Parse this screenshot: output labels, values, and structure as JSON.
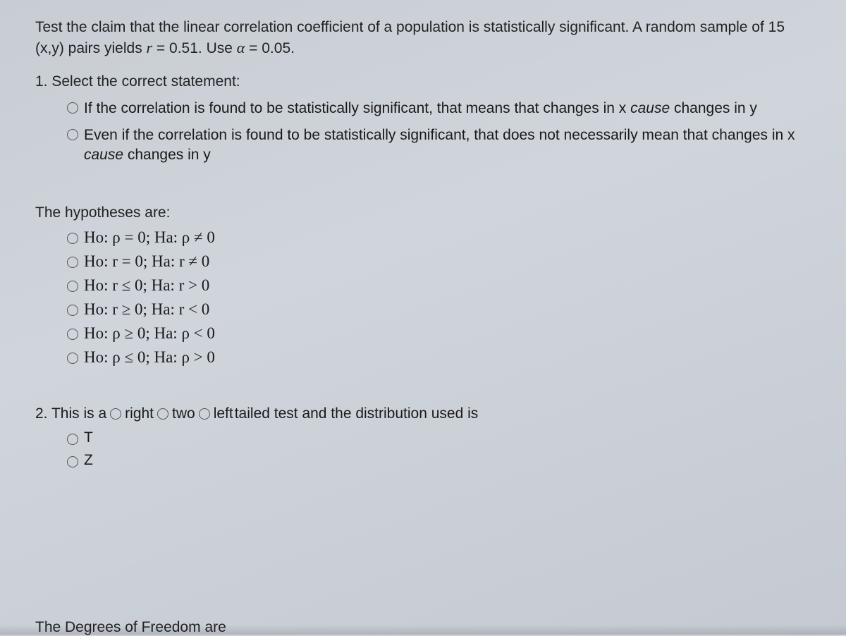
{
  "intro": {
    "part1": "Test the claim that the linear correlation coefficient of a population is statistically significant. A random sample of 15 (x,y) pairs yields ",
    "r_var": "r",
    "eq1": " = 0.51. Use ",
    "alpha_var": "α",
    "eq2": " = 0.05."
  },
  "q1": {
    "prompt": "1. Select the correct statement:",
    "options": [
      {
        "pre": "If the correlation is found to be statistically significant, that means that changes in x ",
        "cause": "cause",
        "post": " changes in y"
      },
      {
        "pre": "Even if the correlation is found to be statistically significant, that does not necessarily mean that changes in x ",
        "cause": "cause",
        "post": " changes in y"
      }
    ]
  },
  "hypotheses": {
    "label": "The hypotheses are:",
    "options": [
      "Ho: ρ = 0;  Ha: ρ ≠ 0",
      "Ho: r = 0;  Ha: r ≠ 0",
      "Ho: r ≤ 0;  Ha: r > 0",
      "Ho: r ≥ 0;  Ha: r < 0",
      "Ho: ρ ≥ 0;  Ha: ρ < 0",
      "Ho: ρ ≤ 0;  Ha: ρ > 0"
    ]
  },
  "q2": {
    "pre": "2. This is a ",
    "tails": [
      "right",
      "two",
      "left"
    ],
    "post": " tailed test and the distribution used is",
    "dist_options": [
      "T",
      "Z"
    ]
  },
  "degrees_label": "The Degrees of Freedom are"
}
